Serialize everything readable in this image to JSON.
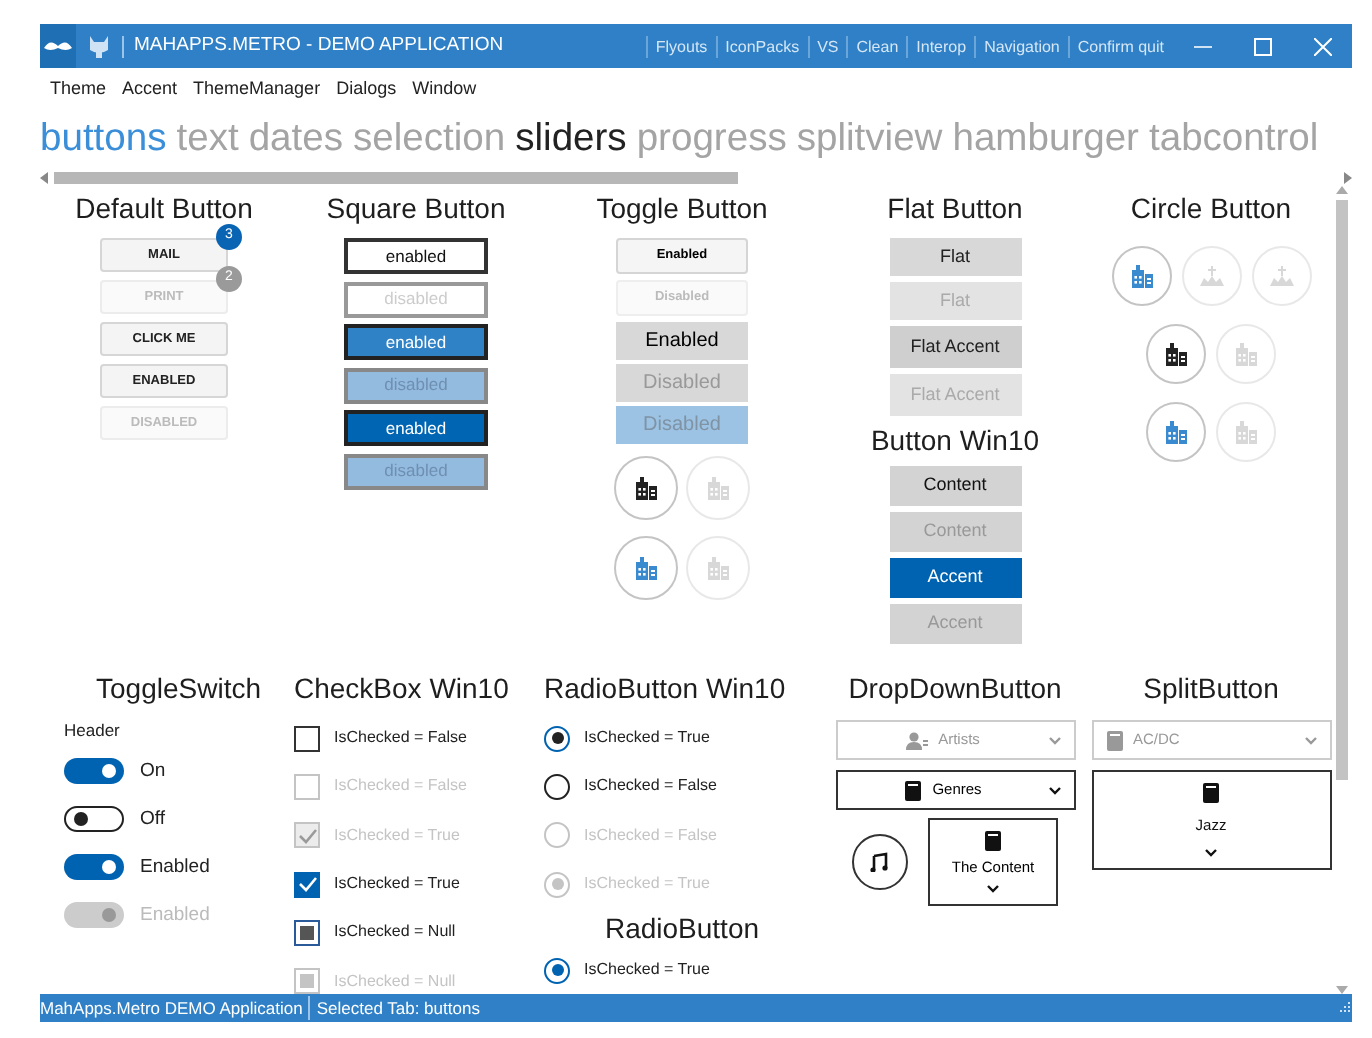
{
  "window": {
    "title": "MAHAPPS.METRO - DEMO APPLICATION",
    "commands": [
      "Flyouts",
      "IconPacks",
      "VS",
      "Clean",
      "Interop",
      "Navigation",
      "Confirm quit"
    ]
  },
  "menu": [
    "Theme",
    "Accent",
    "ThemeManager",
    "Dialogs",
    "Window"
  ],
  "tabs": [
    {
      "label": "buttons",
      "selected": true,
      "hovered": false
    },
    {
      "label": "text",
      "selected": false,
      "hovered": false
    },
    {
      "label": "dates",
      "selected": false,
      "hovered": false
    },
    {
      "label": "selection",
      "selected": false,
      "hovered": false
    },
    {
      "label": "sliders",
      "selected": false,
      "hovered": true
    },
    {
      "label": "progress",
      "selected": false,
      "hovered": false
    },
    {
      "label": "splitview",
      "selected": false,
      "hovered": false
    },
    {
      "label": "hamburger",
      "selected": false,
      "hovered": false
    },
    {
      "label": "tabcontrol",
      "selected": false,
      "hovered": false
    }
  ],
  "default_buttons": {
    "title": "Default Button",
    "buttons": [
      {
        "label": "MAIL",
        "disabled": false,
        "badge": "3"
      },
      {
        "label": "PRINT",
        "disabled": true,
        "badge": "2"
      },
      {
        "label": "CLICK ME",
        "disabled": false
      },
      {
        "label": "ENABLED",
        "disabled": false
      },
      {
        "label": "DISABLED",
        "disabled": true
      }
    ]
  },
  "square_buttons": {
    "title": "Square Button",
    "buttons": [
      {
        "label": "enabled",
        "kind": "plain",
        "disabled": false
      },
      {
        "label": "disabled",
        "kind": "plain",
        "disabled": true
      },
      {
        "label": "enabled",
        "kind": "accent",
        "disabled": false
      },
      {
        "label": "disabled",
        "kind": "accent",
        "disabled": true
      },
      {
        "label": "enabled",
        "kind": "highlight",
        "disabled": false
      },
      {
        "label": "disabled",
        "kind": "highlight",
        "disabled": true
      }
    ]
  },
  "toggle_buttons": {
    "title": "Toggle Button",
    "buttons": [
      {
        "label": "Enabled",
        "kind": "small",
        "disabled": false,
        "checked": false
      },
      {
        "label": "Disabled",
        "kind": "small",
        "disabled": true,
        "checked": false
      },
      {
        "label": "Enabled",
        "kind": "large",
        "disabled": false,
        "checked": false
      },
      {
        "label": "Disabled",
        "kind": "large",
        "disabled": true,
        "checked": false
      },
      {
        "label": "Disabled",
        "kind": "large",
        "disabled": true,
        "checked": true
      }
    ],
    "circles": [
      [
        {
          "kind": "building",
          "accent": false,
          "disabled": false
        },
        {
          "kind": "building",
          "disabled": true
        }
      ],
      [
        {
          "kind": "building",
          "accent": true,
          "disabled": false
        },
        {
          "kind": "building",
          "disabled": true
        }
      ]
    ]
  },
  "flat_buttons": {
    "title": "Flat Button",
    "buttons": [
      {
        "label": "Flat",
        "kind": "flat",
        "disabled": false
      },
      {
        "label": "Flat",
        "kind": "flat",
        "disabled": true
      },
      {
        "label": "Flat Accent",
        "kind": "accent",
        "disabled": false
      },
      {
        "label": "Flat Accent",
        "kind": "accent",
        "disabled": true
      }
    ]
  },
  "win10_buttons": {
    "title": "Button Win10",
    "buttons": [
      {
        "label": "Content",
        "kind": "default",
        "disabled": false
      },
      {
        "label": "Content",
        "kind": "default",
        "disabled": true
      },
      {
        "label": "Accent",
        "kind": "accent",
        "disabled": false
      },
      {
        "label": "Accent",
        "kind": "accent",
        "disabled": true
      }
    ]
  },
  "circle_buttons": {
    "title": "Circle Button",
    "rows": [
      [
        {
          "kind": "building",
          "accent": true,
          "disabled": false
        },
        {
          "kind": "monument",
          "disabled": true
        },
        {
          "kind": "monument",
          "disabled": true
        }
      ],
      [
        {
          "kind": "building",
          "accent": false,
          "disabled": false
        },
        {
          "kind": "building",
          "disabled": true
        }
      ],
      [
        {
          "kind": "building",
          "accent": true,
          "disabled": false
        },
        {
          "kind": "building",
          "disabled": true
        }
      ]
    ]
  },
  "toggle_switches": {
    "title": "ToggleSwitch",
    "header": "Header",
    "switches": [
      {
        "label": "On",
        "on": true,
        "disabled": false
      },
      {
        "label": "Off",
        "on": false,
        "disabled": false
      },
      {
        "label": "Enabled",
        "on": true,
        "disabled": false
      },
      {
        "label": "Enabled",
        "on": true,
        "disabled": true
      }
    ]
  },
  "checkboxes": {
    "title": "CheckBox Win10",
    "items": [
      {
        "label": "IsChecked = False",
        "checked": false,
        "indeterminate": false,
        "disabled": false
      },
      {
        "label": "IsChecked = False",
        "checked": false,
        "indeterminate": false,
        "disabled": true
      },
      {
        "label": "IsChecked = True",
        "checked": true,
        "indeterminate": false,
        "disabled": true
      },
      {
        "label": "IsChecked = True",
        "checked": true,
        "indeterminate": false,
        "disabled": false
      },
      {
        "label": "IsChecked = Null",
        "checked": false,
        "indeterminate": true,
        "disabled": false
      },
      {
        "label": "IsChecked = Null",
        "checked": false,
        "indeterminate": true,
        "disabled": true
      }
    ]
  },
  "radio_win10": {
    "title": "RadioButton Win10",
    "items": [
      {
        "label": "IsChecked = True",
        "checked": true,
        "disabled": false
      },
      {
        "label": "IsChecked = False",
        "checked": false,
        "disabled": false
      },
      {
        "label": "IsChecked = False",
        "checked": false,
        "disabled": true
      },
      {
        "label": "IsChecked = True",
        "checked": true,
        "disabled": true
      }
    ]
  },
  "radio": {
    "title": "RadioButton",
    "items": [
      {
        "label": "IsChecked = True",
        "checked": true
      }
    ]
  },
  "dropdown_buttons": {
    "title": "DropDownButton",
    "dropdowns": [
      {
        "label": "Artists",
        "kind": "person",
        "disabled": true
      },
      {
        "label": "Genres",
        "kind": "book",
        "disabled": false
      }
    ],
    "content_dropdown": {
      "label": "The Content"
    }
  },
  "split_buttons": {
    "title": "SplitButton",
    "items": [
      {
        "label": "AC/DC",
        "kind": "row",
        "disabled": true
      },
      {
        "label": "Jazz",
        "kind": "stacked",
        "disabled": false
      }
    ]
  },
  "status_bar": [
    "MahApps.Metro DEMO Application",
    "Selected Tab: buttons"
  ]
}
